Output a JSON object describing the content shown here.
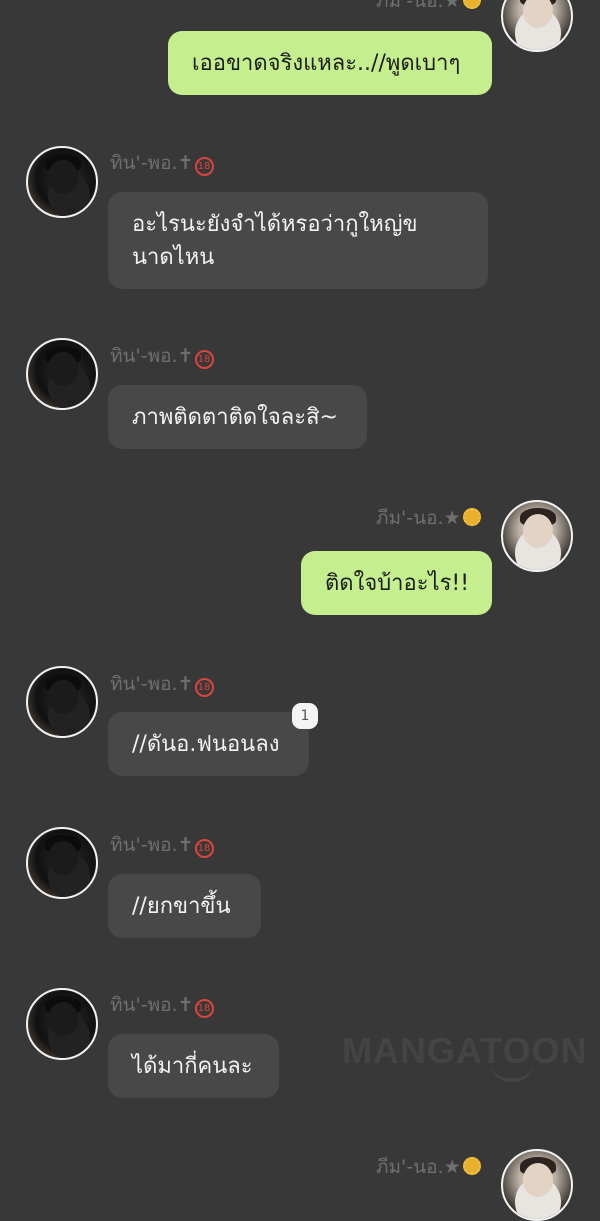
{
  "users": {
    "other": {
      "name": "ทิน'-พอ.✝",
      "badge": "18"
    },
    "me": {
      "name": "ภีม'-นอ.★"
    }
  },
  "messages": [
    {
      "side": "out",
      "text": "เออขาดจริงแหละ..//พูดเบาๆ"
    },
    {
      "side": "in",
      "text": "อะไรนะยังจำได้หรอว่ากูใหญ่ขนาดไหน"
    },
    {
      "side": "in",
      "text": "ภาพติดตาติดใจละสิ~"
    },
    {
      "side": "out",
      "text": "ติดใจบ้าอะไร!!"
    },
    {
      "side": "in",
      "text": "//ดันอ.ฟนอนลง",
      "read_count": "1"
    },
    {
      "side": "in",
      "text": "//ยกขาขึ้น"
    },
    {
      "side": "in",
      "text": "ได้มากี่คนละ"
    }
  ],
  "watermark": "MANGATOON",
  "colors": {
    "background": "#383838",
    "outgoing_bubble": "#c5ee8e",
    "incoming_bubble": "#484848",
    "name_text": "#6f6f6f"
  }
}
